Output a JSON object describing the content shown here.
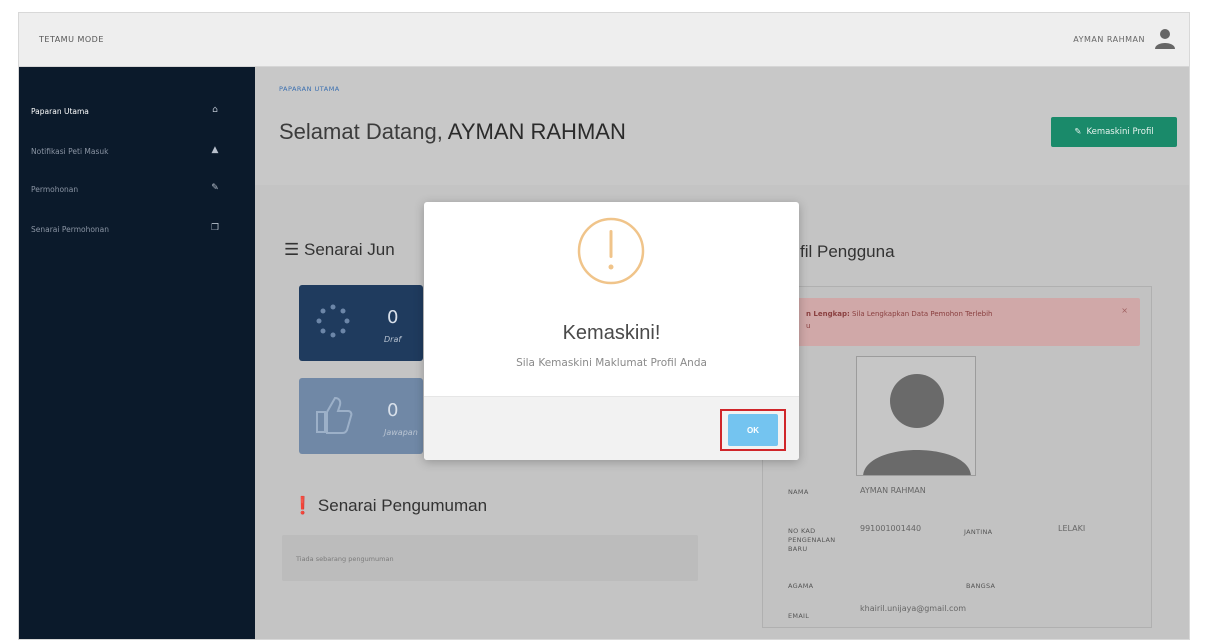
{
  "topbar": {
    "brand": "TETAMU MODE",
    "user_name": "AYMAN RAHMAN"
  },
  "sidebar": {
    "items": [
      {
        "label": "Paparan Utama",
        "icon": "home-icon"
      },
      {
        "label": "Notifikasi Peti Masuk",
        "icon": "bell-icon"
      },
      {
        "label": "Permohonan",
        "icon": "edit-icon"
      },
      {
        "label": "Senarai Permohonan",
        "icon": "copy-icon"
      }
    ]
  },
  "header": {
    "breadcrumb": "PAPARAN UTAMA",
    "welcome_prefix": "Selamat Datang, ",
    "welcome_name": "AYMAN RAHMAN",
    "update_button": "Kemaskini Profil"
  },
  "summary": {
    "title": "Senarai Jun",
    "cards": [
      {
        "value": "0",
        "label": "Draf"
      },
      {
        "value": "0",
        "label": "Jawapan"
      }
    ]
  },
  "announcements": {
    "title": "Senarai Pengumuman",
    "empty_text": "Tiada sebarang pengumuman"
  },
  "profile": {
    "title": "fil Pengguna",
    "alert_bold": "n Lengkap:",
    "alert_text": "Sila Lengkapkan Data Pemohon Terlebih",
    "alert_text2": "u",
    "alert_close": "×",
    "fields": {
      "name_label": "NAMA",
      "name_value": "AYMAN RAHMAN",
      "ic_label": "NO KAD PENGENALAN BARU",
      "ic_value": "991001001440",
      "gender_label": "JANTINA",
      "gender_value": "LELAKI",
      "religion_label": "AGAMA",
      "race_label": "BANGSA",
      "email_label": "EMAIL",
      "email_value": "khairil.unijaya@gmail.com"
    }
  },
  "modal": {
    "title": "Kemaskini!",
    "message": "Sila Kemaskini Maklumat Profil Anda",
    "ok_label": "OK"
  },
  "colors": {
    "sidebar": "#0b1a2b",
    "accent_green": "#1a8a6a",
    "ok_blue": "#74c4f0",
    "highlight_red": "#d0262a",
    "warning_orange": "#f0c48a"
  }
}
